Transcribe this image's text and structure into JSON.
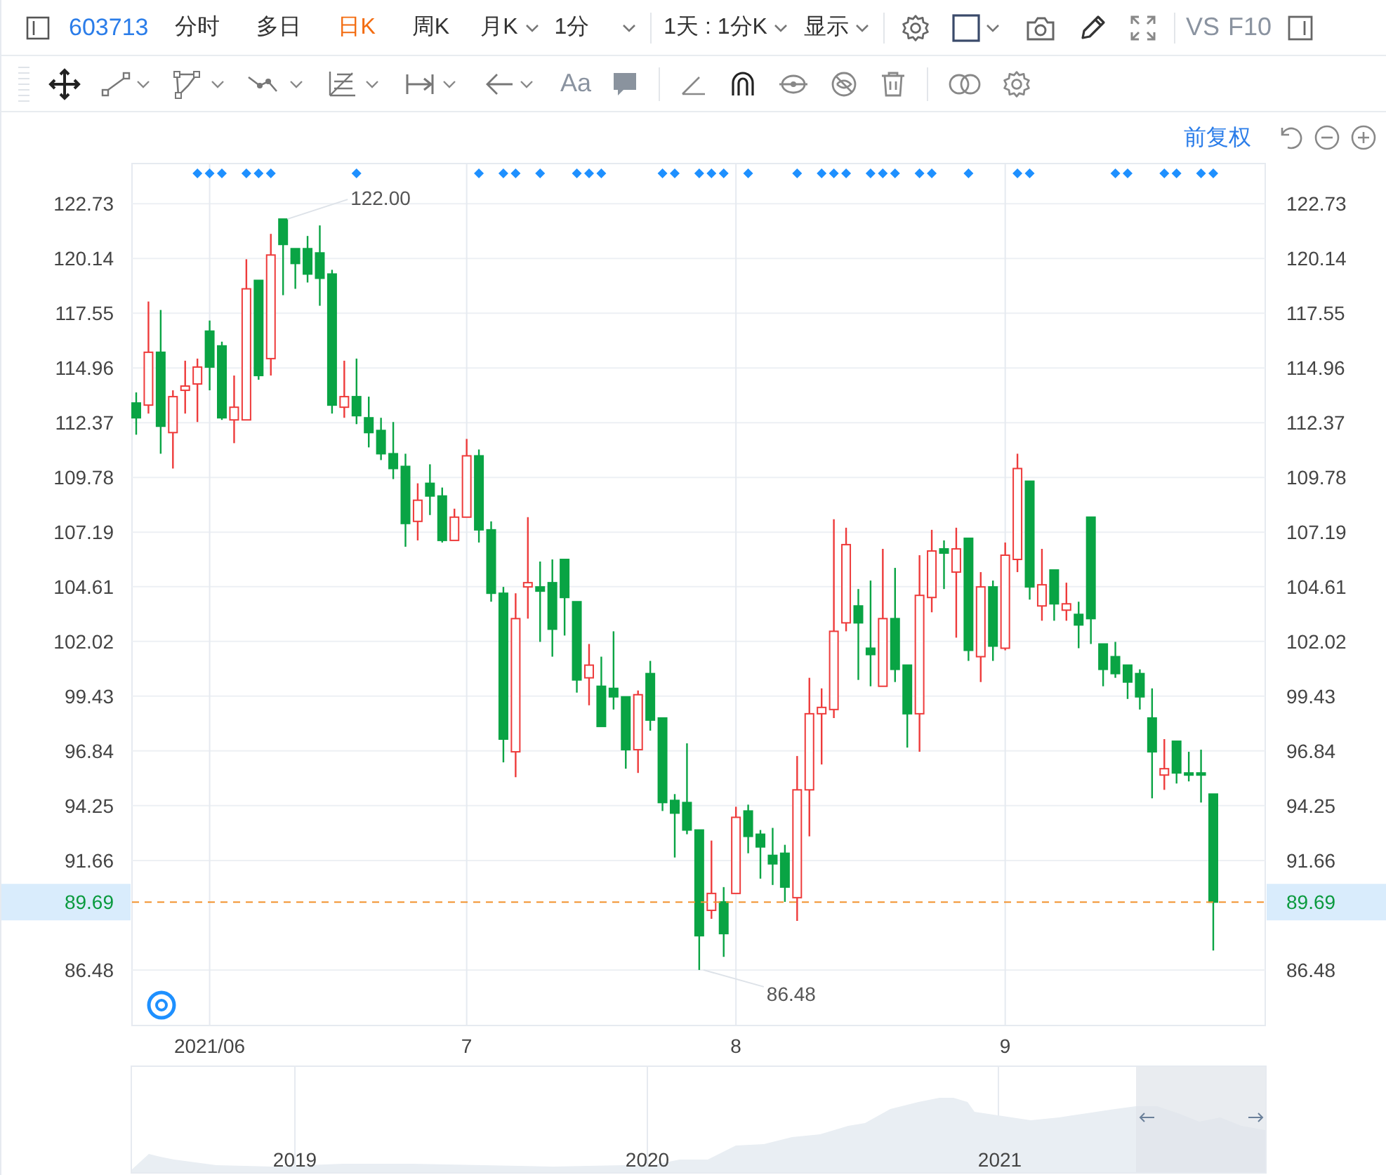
{
  "toolbar": {
    "symbol": "603713",
    "period_tabs": [
      {
        "label": "分时",
        "selected": false
      },
      {
        "label": "多日",
        "selected": false
      },
      {
        "label": "日K",
        "selected": true
      },
      {
        "label": "周K",
        "selected": false
      }
    ],
    "dropdowns": [
      {
        "label": "月K"
      },
      {
        "label": "1分"
      },
      {
        "label": "1天 : 1分K"
      },
      {
        "label": "显示"
      }
    ],
    "text_buttons": [
      "VS",
      "F10"
    ]
  },
  "drawing_toolbar": {
    "text_tool": "Aa"
  },
  "chart_header": {
    "adjust_mode": "前复权"
  },
  "chart": {
    "right_axis_labels": [
      "122.73",
      "120.14",
      "117.55",
      "114.96",
      "112.37",
      "109.78",
      "107.19",
      "104.61",
      "102.02",
      "99.43",
      "96.84",
      "94.25",
      "91.66",
      "86.48"
    ],
    "right_price_label": "89.69",
    "chart_data": {
      "type": "candlestick",
      "grid": true,
      "ylim": [
        83.82,
        124.66
      ],
      "yticks": [
        122.73,
        120.14,
        117.55,
        114.96,
        112.37,
        109.78,
        107.19,
        104.61,
        102.02,
        99.43,
        96.84,
        94.25,
        91.66,
        86.48
      ],
      "categories": [
        null,
        null,
        null,
        null,
        null,
        null,
        "2021/06",
        null,
        null,
        null,
        null,
        null,
        null,
        null,
        null,
        null,
        null,
        null,
        null,
        null,
        null,
        null,
        null,
        null,
        null,
        null,
        null,
        "7",
        null,
        null,
        null,
        null,
        null,
        null,
        null,
        null,
        null,
        null,
        null,
        null,
        null,
        null,
        null,
        null,
        null,
        null,
        null,
        null,
        null,
        "8",
        null,
        null,
        null,
        null,
        null,
        null,
        null,
        null,
        null,
        null,
        null,
        null,
        null,
        null,
        null,
        null,
        null,
        null,
        null,
        null,
        null,
        "9",
        null,
        null,
        null,
        null,
        null,
        null,
        null,
        null,
        null,
        null,
        null,
        null,
        null,
        null,
        null,
        null,
        null
      ],
      "ohlc": [
        [
          113.3,
          113.8,
          111.8,
          112.6
        ],
        [
          113.2,
          118.1,
          112.8,
          115.7
        ],
        [
          115.7,
          117.7,
          110.9,
          112.2
        ],
        [
          111.9,
          113.9,
          110.2,
          113.6
        ],
        [
          113.9,
          115.3,
          112.8,
          114.1
        ],
        [
          114.2,
          115.4,
          112.4,
          115.0
        ],
        [
          116.7,
          117.2,
          113.9,
          115.0
        ],
        [
          116.0,
          116.2,
          112.5,
          112.6
        ],
        [
          112.5,
          114.6,
          111.4,
          113.1
        ],
        [
          112.5,
          120.1,
          112.5,
          118.7
        ],
        [
          119.1,
          119.1,
          114.4,
          114.6
        ],
        [
          115.4,
          121.3,
          114.6,
          120.3
        ],
        [
          122.0,
          122.0,
          118.4,
          120.8
        ],
        [
          120.6,
          120.6,
          118.7,
          119.9
        ],
        [
          120.6,
          121.2,
          119.0,
          119.4
        ],
        [
          120.4,
          121.7,
          117.9,
          119.2
        ],
        [
          119.4,
          119.6,
          112.8,
          113.2
        ],
        [
          113.1,
          115.3,
          112.6,
          113.6
        ],
        [
          113.6,
          115.4,
          112.3,
          112.7
        ],
        [
          112.6,
          113.6,
          111.2,
          111.9
        ],
        [
          112.0,
          112.6,
          110.6,
          110.9
        ],
        [
          110.9,
          112.4,
          109.7,
          110.2
        ],
        [
          110.3,
          110.9,
          106.5,
          107.6
        ],
        [
          107.7,
          109.5,
          106.8,
          108.7
        ],
        [
          109.5,
          110.4,
          108.0,
          108.9
        ],
        [
          108.9,
          109.3,
          106.7,
          106.8
        ],
        [
          106.8,
          108.3,
          106.8,
          107.9
        ],
        [
          107.9,
          111.6,
          107.9,
          110.8
        ],
        [
          110.8,
          111.1,
          106.7,
          107.3
        ],
        [
          107.3,
          107.7,
          103.9,
          104.3
        ],
        [
          104.3,
          104.6,
          96.3,
          97.4
        ],
        [
          96.8,
          104.3,
          95.6,
          103.1
        ],
        [
          104.6,
          107.9,
          103.1,
          104.8
        ],
        [
          104.6,
          105.8,
          102.0,
          104.4
        ],
        [
          104.8,
          105.9,
          101.3,
          102.6
        ],
        [
          105.9,
          105.9,
          102.3,
          104.1
        ],
        [
          103.9,
          103.9,
          99.6,
          100.2
        ],
        [
          100.3,
          101.9,
          99.0,
          100.9
        ],
        [
          99.9,
          101.3,
          98.0,
          98.0
        ],
        [
          99.8,
          102.5,
          98.8,
          99.4
        ],
        [
          99.4,
          99.4,
          96.0,
          96.9
        ],
        [
          96.9,
          99.7,
          95.8,
          99.5
        ],
        [
          100.5,
          101.1,
          97.8,
          98.3
        ],
        [
          98.4,
          98.4,
          94.0,
          94.4
        ],
        [
          94.5,
          94.8,
          91.8,
          93.9
        ],
        [
          94.4,
          97.2,
          92.9,
          93.1
        ],
        [
          93.1,
          93.1,
          86.48,
          88.1
        ],
        [
          89.3,
          92.6,
          88.9,
          90.1
        ],
        [
          89.7,
          90.4,
          87.1,
          88.2
        ],
        [
          90.1,
          94.2,
          90.1,
          93.7
        ],
        [
          94.0,
          94.3,
          92.0,
          92.8
        ],
        [
          92.9,
          93.1,
          90.8,
          92.3
        ],
        [
          91.9,
          93.2,
          90.5,
          91.5
        ],
        [
          92.0,
          92.4,
          89.7,
          90.4
        ],
        [
          89.9,
          96.6,
          88.8,
          95.0
        ],
        [
          95.0,
          100.3,
          92.8,
          98.6
        ],
        [
          98.6,
          99.8,
          96.2,
          98.9
        ],
        [
          98.8,
          107.8,
          98.4,
          102.5
        ],
        [
          102.9,
          107.4,
          102.5,
          106.6
        ],
        [
          103.7,
          104.5,
          100.2,
          102.9
        ],
        [
          101.7,
          104.9,
          99.9,
          101.4
        ],
        [
          99.9,
          106.4,
          99.9,
          103.1
        ],
        [
          103.1,
          105.5,
          100.1,
          100.7
        ],
        [
          100.9,
          100.9,
          97.0,
          98.6
        ],
        [
          98.6,
          106.1,
          96.8,
          104.2
        ],
        [
          104.1,
          107.3,
          103.4,
          106.3
        ],
        [
          106.4,
          106.8,
          104.5,
          106.2
        ],
        [
          105.3,
          107.4,
          102.2,
          106.4
        ],
        [
          106.9,
          106.9,
          101.1,
          101.6
        ],
        [
          101.3,
          105.3,
          100.1,
          104.6
        ],
        [
          104.6,
          104.9,
          101.1,
          101.8
        ],
        [
          101.7,
          106.7,
          101.6,
          106.1
        ],
        [
          105.9,
          110.9,
          105.3,
          110.2
        ],
        [
          109.6,
          109.6,
          104.0,
          104.6
        ],
        [
          103.7,
          106.4,
          103.0,
          104.7
        ],
        [
          105.4,
          105.4,
          103.0,
          103.8
        ],
        [
          103.5,
          104.8,
          103.0,
          103.8
        ],
        [
          103.3,
          103.9,
          101.7,
          102.8
        ],
        [
          107.9,
          107.9,
          101.9,
          103.1
        ],
        [
          101.9,
          101.9,
          99.9,
          100.7
        ],
        [
          101.3,
          102.0,
          100.3,
          100.5
        ],
        [
          100.9,
          100.9,
          99.3,
          100.1
        ],
        [
          100.5,
          100.7,
          98.8,
          99.4
        ],
        [
          98.4,
          99.8,
          94.6,
          96.8
        ],
        [
          95.7,
          97.4,
          95.0,
          96.0
        ],
        [
          97.3,
          97.3,
          95.3,
          95.8
        ],
        [
          95.8,
          96.8,
          95.4,
          95.7
        ],
        [
          95.8,
          96.9,
          94.4,
          95.7
        ],
        [
          94.8,
          94.8,
          87.4,
          89.69
        ]
      ],
      "ref_lines": [
        {
          "axis": "y",
          "value": 89.69,
          "label": "89.69"
        }
      ],
      "annotations": [
        "122.00",
        "86.48"
      ]
    }
  },
  "navigator": {
    "year_labels": [
      "2019",
      "2020",
      "2021"
    ]
  }
}
